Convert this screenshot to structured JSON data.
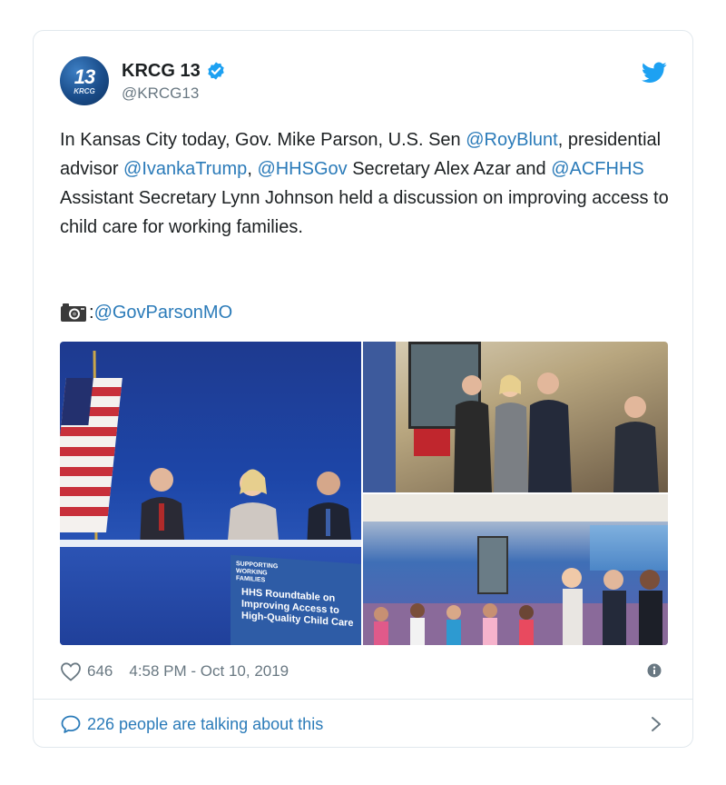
{
  "tweet": {
    "display_name": "KRCG 13",
    "handle": "@KRCG13",
    "avatar_text": "13",
    "avatar_sub": "KRCG",
    "verified": true,
    "text_parts": [
      {
        "t": "In Kansas City today, Gov. Mike Parson, U.S. Sen ",
        "link": false
      },
      {
        "t": "@RoyBlunt",
        "link": true
      },
      {
        "t": ", presidential advisor ",
        "link": false
      },
      {
        "t": "@IvankaTrump",
        "link": true
      },
      {
        "t": ",  ",
        "link": false
      },
      {
        "t": "@HHSGov",
        "link": true
      },
      {
        "t": " Secretary Alex Azar and ",
        "link": false
      },
      {
        "t": "@ACFHHS",
        "link": true
      },
      {
        "t": " Assistant Secretary Lynn Johnson held a discussion on improving access to child care for working families.",
        "link": false
      }
    ],
    "photo_credit_sep": ": ",
    "photo_credit": "@GovParsonMO",
    "likes": "646",
    "timestamp": "4:58 PM - Oct 10, 2019",
    "talking": "226 people are talking about this"
  },
  "media": {
    "banner_text": "HHS Roundtable on Improving Access to High-Quality Child Care",
    "banner_sub": "SUPPORTING WORKING FAMILIES"
  },
  "colors": {
    "link": "#2b7bb9",
    "muted": "#697882",
    "twitter_blue": "#1da1f2"
  },
  "icons": [
    "verified-badge-icon",
    "twitter-bird-icon",
    "camera-icon",
    "heart-icon",
    "info-icon",
    "speech-bubble-icon",
    "chevron-right-icon"
  ]
}
